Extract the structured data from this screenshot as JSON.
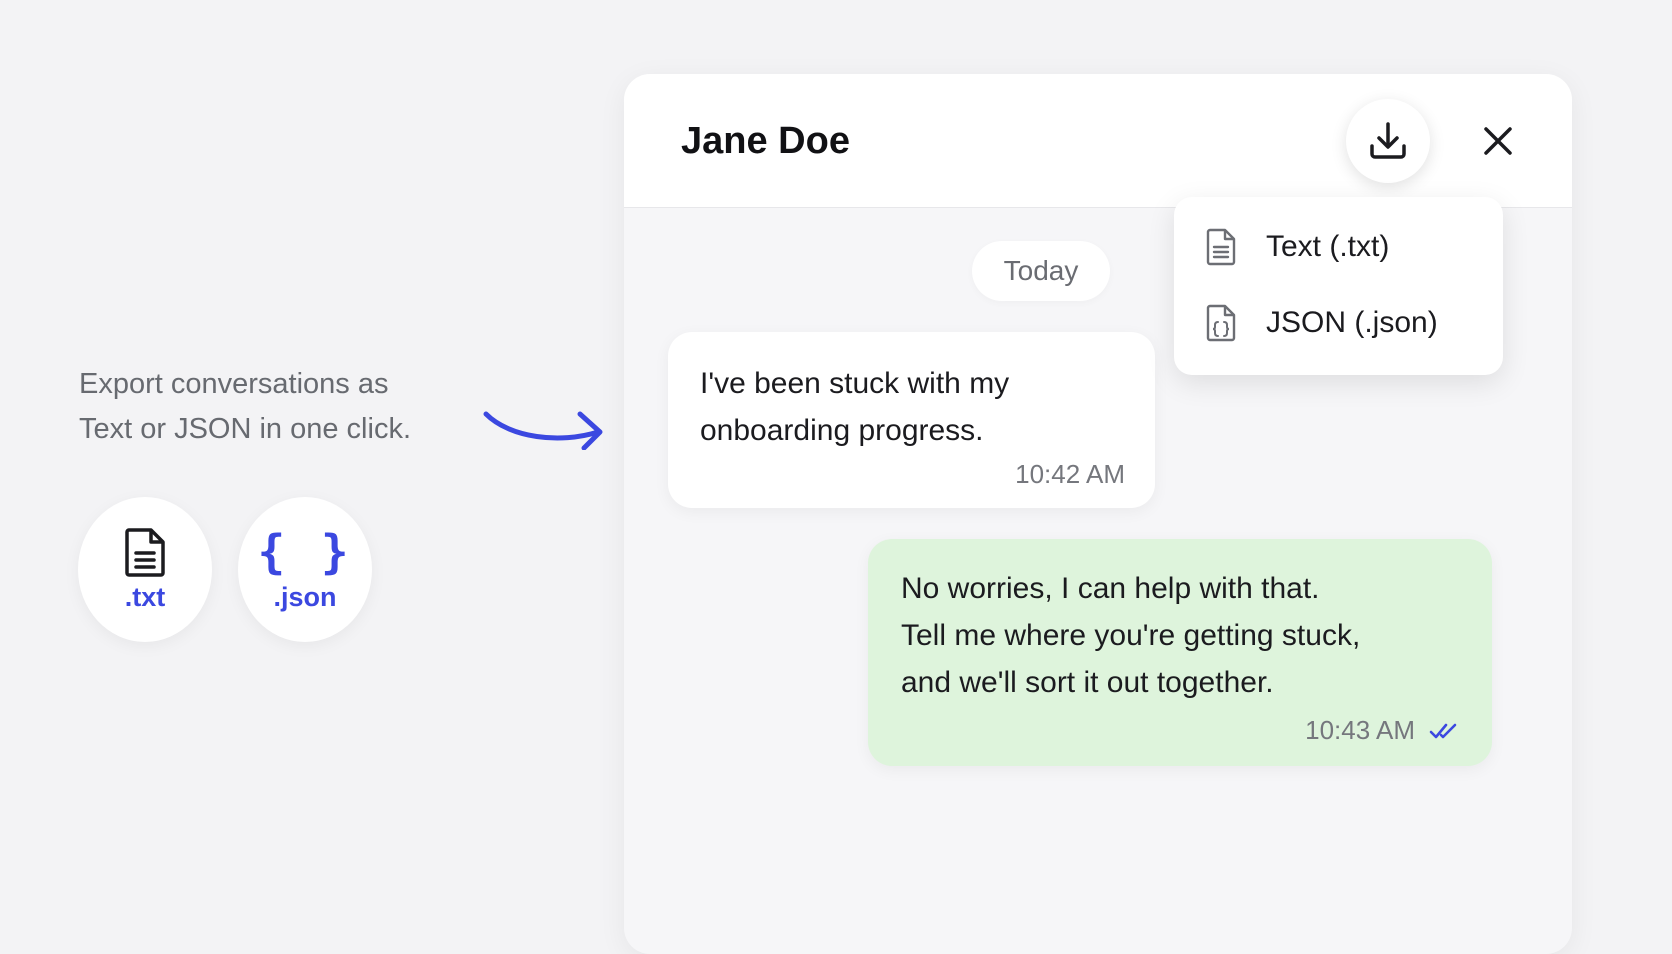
{
  "colors": {
    "accent": "#3b48e0",
    "background": "#f3f3f5",
    "outgoing_bubble": "#def4dc",
    "incoming_bubble": "#ffffff"
  },
  "promo": {
    "lines": [
      "Export conversations as",
      "Text or JSON in one click."
    ],
    "formats": [
      {
        "icon": "file-text-icon",
        "label": ".txt"
      },
      {
        "icon": "braces-icon",
        "label": ".json",
        "glyph": "{ }"
      }
    ]
  },
  "chat": {
    "contact_name": "Jane Doe",
    "header_icons": [
      "download-icon",
      "close-icon"
    ],
    "date_divider": "Today",
    "messages": [
      {
        "direction": "incoming",
        "lines": [
          "I've been stuck with my",
          "onboarding progress."
        ],
        "time": "10:42 AM"
      },
      {
        "direction": "outgoing",
        "lines": [
          "No worries, I can help with that.",
          "Tell me where you're getting stuck,",
          "and we'll sort it out together."
        ],
        "time": "10:43 AM",
        "status_icon": "double-check-icon"
      }
    ]
  },
  "export_menu": {
    "items": [
      {
        "icon": "file-text-icon",
        "label": "Text (.txt)"
      },
      {
        "icon": "file-json-icon",
        "label": "JSON (.json)"
      }
    ]
  }
}
